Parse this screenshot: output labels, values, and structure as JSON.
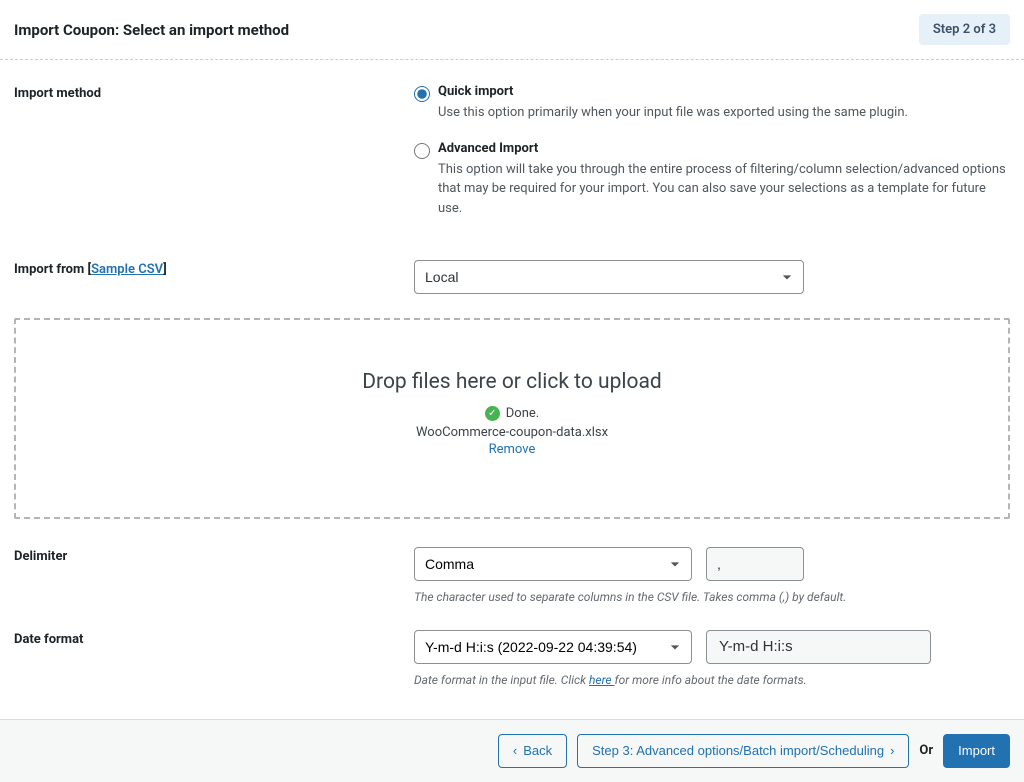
{
  "header": {
    "title": "Import Coupon: Select an import method",
    "step_badge": "Step 2 of 3"
  },
  "import_method": {
    "label": "Import method",
    "quick": {
      "title": "Quick import",
      "desc": "Use this option primarily when your input file was exported using the same plugin."
    },
    "advanced": {
      "title": "Advanced Import",
      "desc": "This option will take you through the entire process of filtering/column selection/advanced options that may be required for your import. You can also save your selections as a template for future use."
    }
  },
  "import_from": {
    "label_prefix": "Import from [",
    "sample_link": "Sample CSV",
    "label_suffix": "]",
    "select_value": "Local"
  },
  "dropzone": {
    "title": "Drop files here or click to upload",
    "done": "Done.",
    "filename": "WooCommerce-coupon-data.xlsx",
    "remove": "Remove"
  },
  "delimiter": {
    "label": "Delimiter",
    "select_value": "Comma",
    "char_value": ",",
    "help": "The character used to separate columns in the CSV file. Takes comma (,) by default."
  },
  "date_format": {
    "label": "Date format",
    "select_value": "Y-m-d H:i:s (2022-09-22 04:39:54)",
    "pattern_value": "Y-m-d H:i:s",
    "help_prefix": "Date format in the input file. Click ",
    "help_link": "here ",
    "help_suffix": "for more info about the date formats."
  },
  "footer": {
    "back": "Back",
    "next": "Step 3: Advanced options/Batch import/Scheduling",
    "or": "Or",
    "import": "Import"
  }
}
